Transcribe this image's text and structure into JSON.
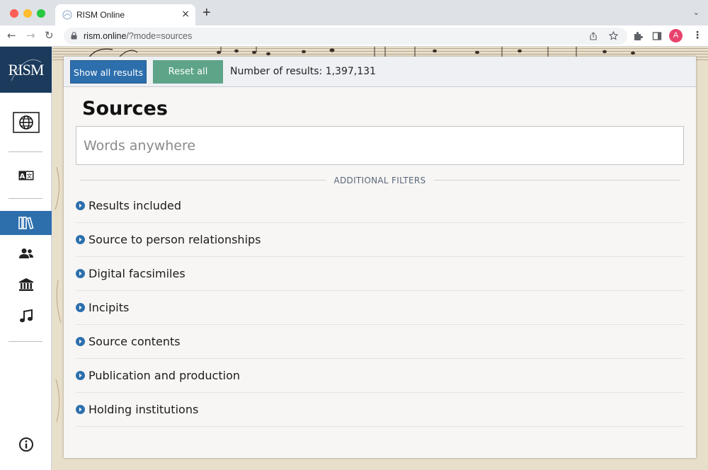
{
  "browser": {
    "tab_title": "RISM Online",
    "url_host": "rism.online",
    "url_path": "/?mode=sources",
    "avatar_letter": "A"
  },
  "sidebar": {
    "logo": "RISM",
    "items": [
      {
        "name": "globe-icon",
        "active": false
      },
      {
        "name": "language-icon",
        "active": false
      },
      {
        "name": "sources-icon",
        "active": true
      },
      {
        "name": "people-icon",
        "active": false
      },
      {
        "name": "institutions-icon",
        "active": false
      },
      {
        "name": "incipits-icon",
        "active": false
      },
      {
        "name": "info-icon",
        "active": false
      }
    ]
  },
  "toolbar": {
    "show_all_label": "Show all results",
    "reset_label": "Reset all",
    "count_label": "Number of results: 1,397,131"
  },
  "main": {
    "heading": "Sources",
    "search_placeholder": "Words anywhere",
    "filters_heading": "ADDITIONAL FILTERS",
    "filters": [
      "Results included",
      "Source to person relationships",
      "Digital facsimiles",
      "Incipits",
      "Source contents",
      "Publication and production",
      "Holding institutions"
    ]
  },
  "colors": {
    "accent": "#2d6fad",
    "reset": "#5da488",
    "logo_bg": "#1b3a5c"
  }
}
